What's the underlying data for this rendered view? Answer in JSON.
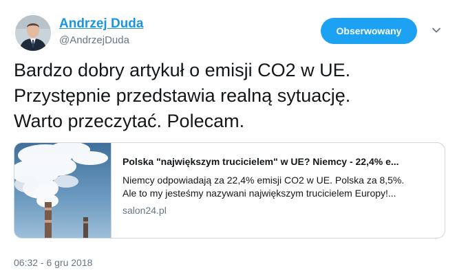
{
  "author": {
    "name": "Andrzej Duda",
    "handle": "@AndrzejDuda"
  },
  "follow_button": {
    "label": "Obserwowany"
  },
  "tweet": {
    "lines": [
      "Bardzo dobry artykuł o emisji CO2 w UE.",
      "Przystępnie przedstawia realną sytuację.",
      "Warto przeczytać. Polecam."
    ]
  },
  "card": {
    "title": "Polska \"największym trucicielem\" w UE? Niemcy - 22,4% e...",
    "description_lines": [
      "Niemcy odpowiadają za 22,4% emisji CO2 w UE. Polska za 8,5%.",
      "Ale to my jesteśmy nazywani największym trucicielem Europy!..."
    ],
    "domain": "salon24.pl",
    "image_icon": "smokestack-photo"
  },
  "timestamp": "06:32 - 6 gru 2018",
  "colors": {
    "link": "#1b95e0",
    "button": "#1da1f2",
    "muted": "#657786",
    "border": "#ccd6dd"
  }
}
